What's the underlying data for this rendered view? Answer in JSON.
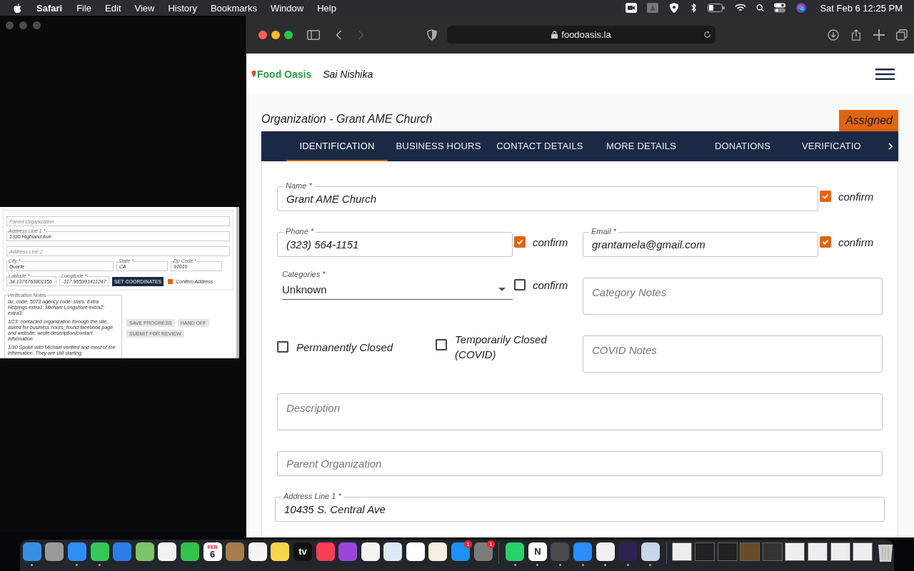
{
  "menu_bar": {
    "app": "Safari",
    "menus": [
      "File",
      "Edit",
      "View",
      "History",
      "Bookmarks",
      "Window",
      "Help"
    ],
    "clock": "Sat Feb 6  12:25 PM"
  },
  "inset_screenshot": {
    "parent_organization": {
      "placeholder": "Parent Organization"
    },
    "address_line_1": {
      "label": "Address Line 1 *",
      "value": "1330 Highland Ave"
    },
    "address_line_2": {
      "placeholder": "Address Line 2"
    },
    "city": {
      "label": "City *",
      "value": "Duarte"
    },
    "state": {
      "label": "State *",
      "value": "CA"
    },
    "zip": {
      "label": "Zip Code *",
      "value": "91010"
    },
    "latitude": {
      "label": "Latitude *",
      "value": "34.1376763801156"
    },
    "longitude": {
      "label": "Longitude *",
      "value": "-117.965991411247"
    },
    "coordinates_button": "SET COORDINATES",
    "confirm_address": {
      "label": "Confirm Address",
      "checked": true
    },
    "notes_label": "Verification Notes",
    "notes": [
      "lar_code: 5073 agency code:  stars: Extra Helpings extra1: Michael Longshore extra2:  extra3:",
      "1/23: contacted organization through the site, asked for business hours; found facebook page and website; wrote description/contact information",
      "1/30 Spoke with Michael verified and most of the information. They are still starting"
    ],
    "actions": [
      "SAVE PROGRESS",
      "HAND OFF",
      "SUBMIT FOR REVIEW"
    ]
  },
  "browser": {
    "url": "foodoasis.la"
  },
  "site": {
    "logo": "Food Oasis",
    "user": "Sai Nishika"
  },
  "page": {
    "title": "Organization - Grant AME Church",
    "status": "Assigned",
    "tabs": [
      {
        "label": "IDENTIFICATION",
        "selected": true
      },
      {
        "label": "BUSINESS HOURS",
        "selected": false
      },
      {
        "label": "CONTACT DETAILS",
        "selected": false
      },
      {
        "label": "MORE DETAILS",
        "selected": false
      },
      {
        "label": "DONATIONS",
        "selected": false
      },
      {
        "label": "VERIFICATIO",
        "selected": false
      }
    ],
    "form": {
      "name": {
        "label": "Name *",
        "value": "Grant AME Church",
        "confirm": {
          "label": "confirm",
          "checked": true
        }
      },
      "phone": {
        "label": "Phone *",
        "value": "(323) 564-1151",
        "confirm": {
          "label": "confirm",
          "checked": true
        }
      },
      "email": {
        "label": "Email *",
        "value": "grantamela@gmail.com",
        "confirm": {
          "label": "confirm",
          "checked": true
        }
      },
      "categories": {
        "label": "Categories *",
        "value": "Unknown",
        "confirm": {
          "label": "confirm",
          "checked": false
        }
      },
      "category_notes": {
        "placeholder": "Category Notes"
      },
      "permanently_closed": {
        "label": "Permanently Closed",
        "checked": false
      },
      "temporarily_closed": {
        "label": "Temporarily Closed (COVID)",
        "checked": false
      },
      "covid_notes": {
        "placeholder": "COVID Notes"
      },
      "description": {
        "placeholder": "Description"
      },
      "parent_organization": {
        "placeholder": "Parent Organization"
      },
      "address_line_1": {
        "label": "Address Line 1 *",
        "value": "10435 S. Central Ave"
      }
    }
  },
  "dock": {
    "items": [
      {
        "kind": "app",
        "color": "#3a8ee6",
        "running": true
      },
      {
        "kind": "app",
        "color": "#9a9a9a",
        "running": false
      },
      {
        "kind": "app",
        "color": "#2f8ef5",
        "running": true
      },
      {
        "kind": "app",
        "color": "#35c759",
        "running": true
      },
      {
        "kind": "app",
        "color": "#2b7ee8",
        "running": false
      },
      {
        "kind": "app",
        "color": "#7fc36a",
        "running": false
      },
      {
        "kind": "app",
        "color": "#f2f2f2",
        "running": false
      },
      {
        "kind": "app",
        "color": "#33c24d",
        "running": false
      },
      {
        "kind": "app",
        "color": "#ffffff",
        "running": false,
        "top": "FEB",
        "text": "6"
      },
      {
        "kind": "app",
        "color": "#a67c4e",
        "running": false
      },
      {
        "kind": "app",
        "color": "#f5f5f5",
        "running": false
      },
      {
        "kind": "app",
        "color": "#f7d54a",
        "running": false
      },
      {
        "kind": "app",
        "color": "#111111",
        "running": false,
        "text": "tv"
      },
      {
        "kind": "app",
        "color": "#fa3d55",
        "running": false
      },
      {
        "kind": "app",
        "color": "#9b45d8",
        "running": false
      },
      {
        "kind": "app",
        "color": "#f5f5f5",
        "running": false
      },
      {
        "kind": "app",
        "color": "#dce8f5",
        "running": false
      },
      {
        "kind": "app",
        "color": "#ffffff",
        "running": false
      },
      {
        "kind": "app",
        "color": "#f5f0e0",
        "running": false
      },
      {
        "kind": "app",
        "color": "#1f8ef5",
        "running": false,
        "badge": "1"
      },
      {
        "kind": "app",
        "color": "#7a7a7a",
        "running": false,
        "badge": "1"
      },
      {
        "kind": "separator"
      },
      {
        "kind": "app",
        "color": "#25d366",
        "running": true
      },
      {
        "kind": "app",
        "color": "#ffffff",
        "running": true,
        "text": "N"
      },
      {
        "kind": "app",
        "color": "#4a4a4a",
        "running": true
      },
      {
        "kind": "app",
        "color": "#2d8cff",
        "running": true
      },
      {
        "kind": "app",
        "color": "#f0f0f0",
        "running": true
      },
      {
        "kind": "app",
        "color": "#2c2255",
        "running": true
      },
      {
        "kind": "app",
        "color": "#c7d6e8",
        "running": true
      },
      {
        "kind": "separator"
      },
      {
        "kind": "thumbnail",
        "color": "#eeeeee"
      },
      {
        "kind": "thumbnail",
        "color": "#222222"
      },
      {
        "kind": "thumbnail",
        "color": "#222222"
      },
      {
        "kind": "thumbnail",
        "color": "#6b4a2a"
      },
      {
        "kind": "thumbnail",
        "color": "#333333"
      },
      {
        "kind": "thumbnail",
        "color": "#eeeeee"
      },
      {
        "kind": "thumbnail",
        "color": "#eeeeee"
      },
      {
        "kind": "thumbnail",
        "color": "#eeeeee"
      },
      {
        "kind": "thumbnail",
        "color": "#eeeeee"
      },
      {
        "kind": "trash",
        "color": "#cfcfcf"
      }
    ]
  }
}
